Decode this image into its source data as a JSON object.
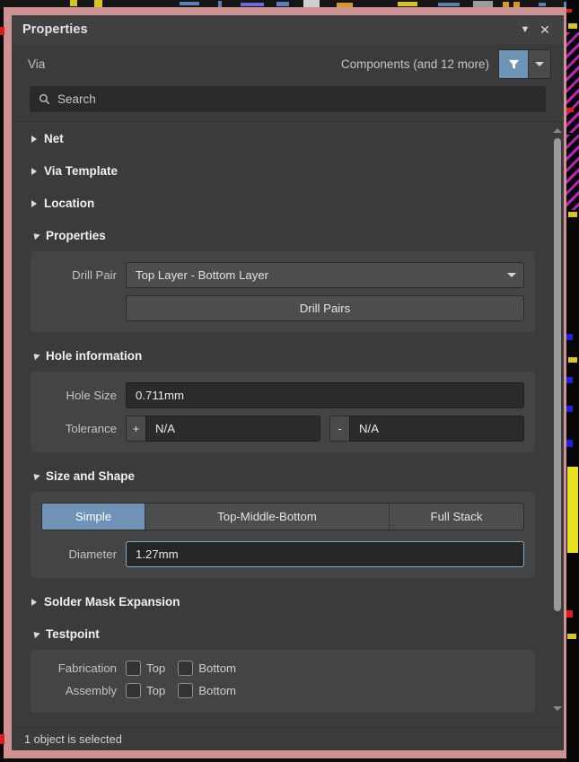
{
  "window": {
    "title": "Properties",
    "collapse_icon": "chevron-down-icon",
    "close_icon": "close-icon"
  },
  "header": {
    "object_type": "Via",
    "scope": "Components (and 12 more)",
    "filter_icon": "funnel-icon",
    "filter_dropdown_icon": "chevron-down-icon"
  },
  "search": {
    "icon": "search-icon",
    "placeholder": "Search",
    "value": ""
  },
  "sections": {
    "net": {
      "label": "Net",
      "expanded": false
    },
    "via_template": {
      "label": "Via Template",
      "expanded": false
    },
    "location": {
      "label": "Location",
      "expanded": false
    },
    "properties": {
      "label": "Properties",
      "expanded": true,
      "drill_pair_label": "Drill Pair",
      "drill_pair_value": "Top Layer - Bottom Layer",
      "drill_pairs_button": "Drill Pairs"
    },
    "hole_information": {
      "label": "Hole information",
      "expanded": true,
      "hole_size_label": "Hole Size",
      "hole_size_value": "0.711mm",
      "tolerance_label": "Tolerance",
      "tolerance_plus_sign": "+",
      "tolerance_plus_value": "N/A",
      "tolerance_minus_sign": "-",
      "tolerance_minus_value": "N/A"
    },
    "size_and_shape": {
      "label": "Size and Shape",
      "expanded": true,
      "modes": [
        "Simple",
        "Top-Middle-Bottom",
        "Full Stack"
      ],
      "selected_mode": "Simple",
      "diameter_label": "Diameter",
      "diameter_value": "1.27mm"
    },
    "solder_mask_expansion": {
      "label": "Solder Mask Expansion",
      "expanded": false
    },
    "testpoint": {
      "label": "Testpoint",
      "expanded": true,
      "rows": [
        {
          "label": "Fabrication",
          "top": "Top",
          "top_checked": false,
          "bottom": "Bottom",
          "bottom_checked": false
        },
        {
          "label": "Assembly",
          "top": "Top",
          "top_checked": false,
          "bottom": "Bottom",
          "bottom_checked": false
        }
      ]
    }
  },
  "scrollbar": {
    "up_icon": "triangle-up-icon",
    "down_icon": "triangle-down-icon"
  },
  "statusbar": {
    "text": "1 object is selected"
  },
  "colors": {
    "accent_blue": "#6f93b6",
    "selection_frame": "#cf9292",
    "panel_bg": "#3b3b3b",
    "group_bg": "#444444",
    "input_bg": "#2b2b2b",
    "focus_border": "#7fa8cf"
  }
}
